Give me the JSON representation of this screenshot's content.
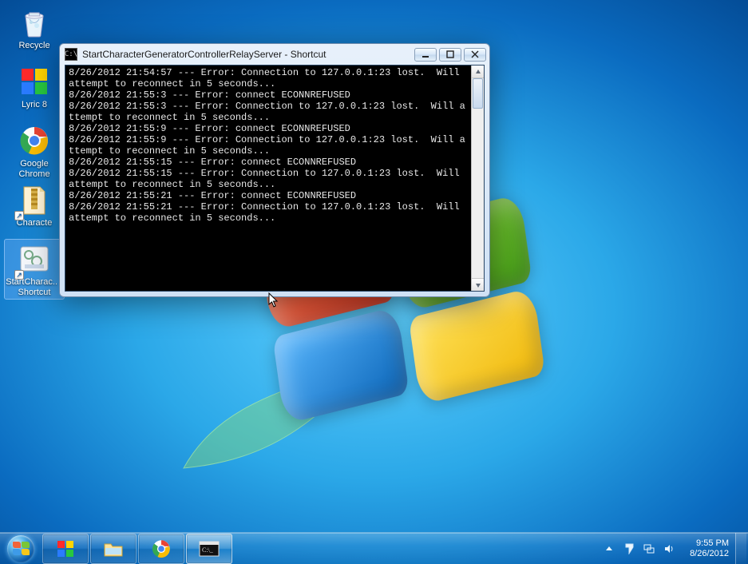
{
  "desktop": {
    "icons": [
      {
        "name": "recycle-bin",
        "label": "Recycle"
      },
      {
        "name": "lyric8",
        "label": "Lyric 8"
      },
      {
        "name": "google-chrome",
        "label": "Google Chrome"
      },
      {
        "name": "characte",
        "label": "Characte"
      },
      {
        "name": "start-shortcut",
        "label": "StartCharac.. - Shortcut",
        "selected": true
      }
    ]
  },
  "window": {
    "title": "StartCharacterGeneratorControllerRelayServer - Shortcut",
    "console_lines": [
      "8/26/2012 21:54:57 --- Error: Connection to 127.0.0.1:23 lost.  Will attempt to reconnect in 5 seconds...",
      "",
      "8/26/2012 21:55:3 --- Error: connect ECONNREFUSED",
      "",
      "8/26/2012 21:55:3 --- Error: Connection to 127.0.0.1:23 lost.  Will attempt to reconnect in 5 seconds...",
      "",
      "8/26/2012 21:55:9 --- Error: connect ECONNREFUSED",
      "",
      "8/26/2012 21:55:9 --- Error: Connection to 127.0.0.1:23 lost.  Will attempt to reconnect in 5 seconds...",
      "",
      "8/26/2012 21:55:15 --- Error: connect ECONNREFUSED",
      "",
      "8/26/2012 21:55:15 --- Error: Connection to 127.0.0.1:23 lost.  Will attempt to reconnect in 5 seconds...",
      "",
      "8/26/2012 21:55:21 --- Error: connect ECONNREFUSED",
      "",
      "8/26/2012 21:55:21 --- Error: Connection to 127.0.0.1:23 lost.  Will attempt to reconnect in 5 seconds...",
      ""
    ]
  },
  "taskbar": {
    "buttons": [
      {
        "name": "lyric8-task",
        "active": false
      },
      {
        "name": "explorer-task",
        "active": false
      },
      {
        "name": "chrome-task",
        "active": false
      },
      {
        "name": "console-task",
        "active": true
      }
    ],
    "tray": {
      "time": "9:55 PM",
      "date": "8/26/2012"
    }
  }
}
